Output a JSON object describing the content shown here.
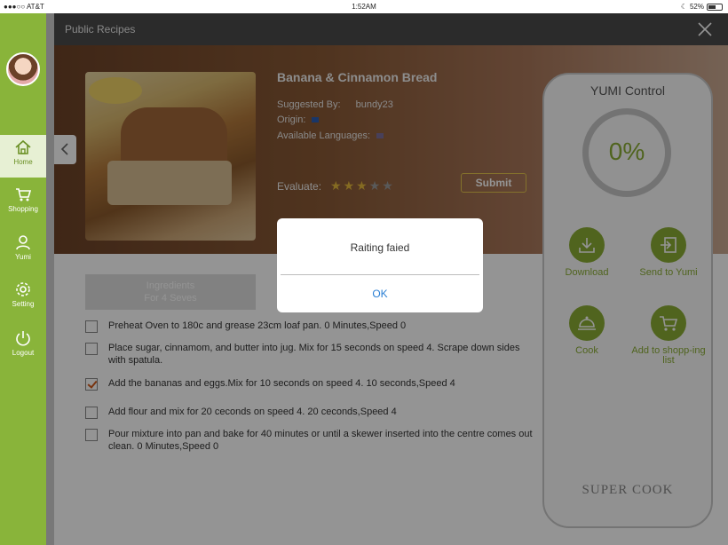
{
  "status_bar": {
    "carrier": "●●●○○ AT&T",
    "time": "1:52AM",
    "battery": "52%",
    "battery_level": 0.52
  },
  "sidebar": {
    "items": [
      {
        "label": "Home",
        "icon": "home-icon",
        "active": true
      },
      {
        "label": "Shopping",
        "icon": "cart-icon"
      },
      {
        "label": "Yumi",
        "icon": "user-icon"
      },
      {
        "label": "Setting",
        "icon": "gear-icon"
      },
      {
        "label": "Logout",
        "icon": "power-icon"
      }
    ]
  },
  "header": {
    "title": "Public Recipes"
  },
  "recipe": {
    "title": "Banana & Cinnamon Bread",
    "suggested_by_label": "Suggested By:",
    "suggested_by": "bundy23",
    "origin_label": "Origin:",
    "languages_label": "Available Languages:",
    "evaluate_label": "Evaluate:",
    "rating": 3,
    "rating_max": 5,
    "submit_label": "Submit"
  },
  "ingredients_tab": {
    "line1": "Ingredients",
    "line2": "For 4 Seves"
  },
  "steps": [
    {
      "text": "Preheat Oven to 180c and grease 23cm loaf pan.  0 Minutes,Speed 0",
      "checked": false
    },
    {
      "text": "Place sugar, cinnamom, and butter into jug. Mix for 15 seconds on speed 4. Scrape down sides with spatula.",
      "checked": false
    },
    {
      "text": "Add the bananas and eggs.Mix for 10 seconds on speed 4.  10 seconds,Speed 4",
      "checked": true
    },
    {
      "text": "Add flour and mix for 20 ceconds on speed 4.   20 ceconds,Speed 4",
      "checked": false
    },
    {
      "text": "Pour mixture into pan and bake for 40 minutes or until a skewer inserted into the centre comes out clean.  0 Minutes,Speed 0",
      "checked": false
    }
  ],
  "yumi_control": {
    "title": "YUMI Control",
    "progress": "0%",
    "download_label": "Download",
    "send_label": "Send to Yumi",
    "cook_label": "Cook",
    "add_shopping_label": "Add to shopp-ing list",
    "brand": "SUPER COOK"
  },
  "alert": {
    "message": "Raiting faied",
    "ok_label": "OK"
  },
  "colors": {
    "accent": "#89b43a",
    "dialog_link": "#2a7fd4",
    "star": "#e6b83b"
  }
}
